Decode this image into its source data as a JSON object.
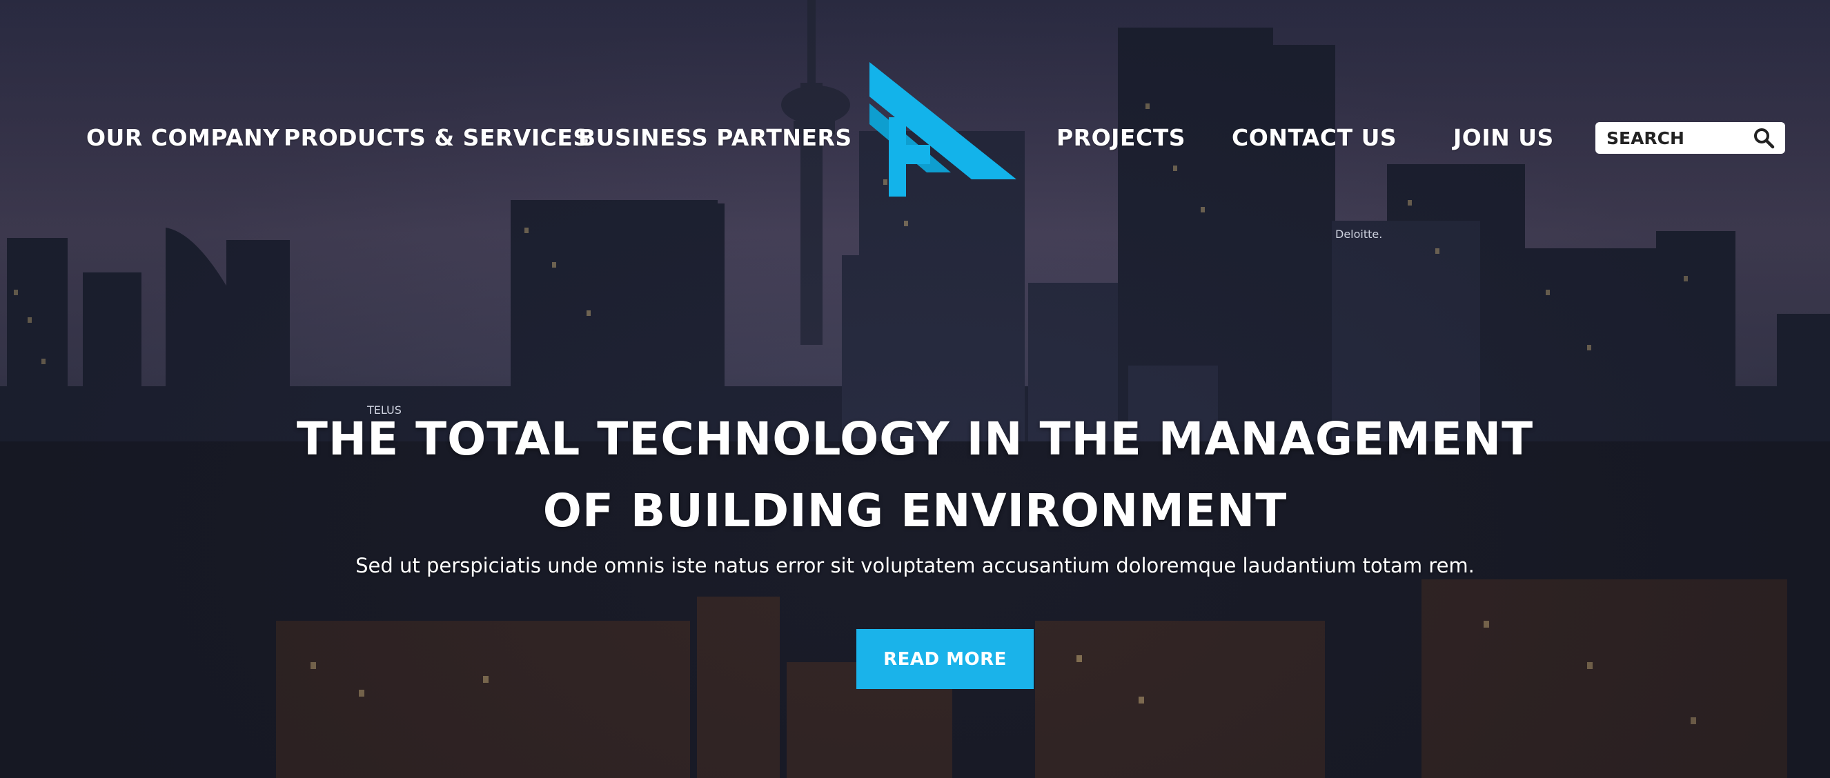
{
  "nav": {
    "left": [
      "OUR COMPANY",
      "PRODUCTS & SERVICES",
      "BUSINESS PARTNERS"
    ],
    "right": [
      "PROJECTS",
      "CONTACT US",
      "JOIN US"
    ]
  },
  "search": {
    "placeholder": "SEARCH"
  },
  "hero": {
    "headline_line1": "THE TOTAL TECHNOLOGY IN THE MANAGEMENT",
    "headline_line2": "OF BUILDING ENVIRONMENT",
    "subtitle": "Sed ut perspiciatis unde omnis iste natus error sit voluptatem accusantium doloremque laudantium totam rem.",
    "cta_label": "READ MORE"
  },
  "signage": [
    "TELUS",
    "Deloitte."
  ],
  "colors": {
    "accent": "#1ab3ea",
    "nav_text": "#ffffff",
    "search_bg": "#ffffff"
  },
  "icons": {
    "search": "search-icon",
    "logo": "company-logo"
  }
}
